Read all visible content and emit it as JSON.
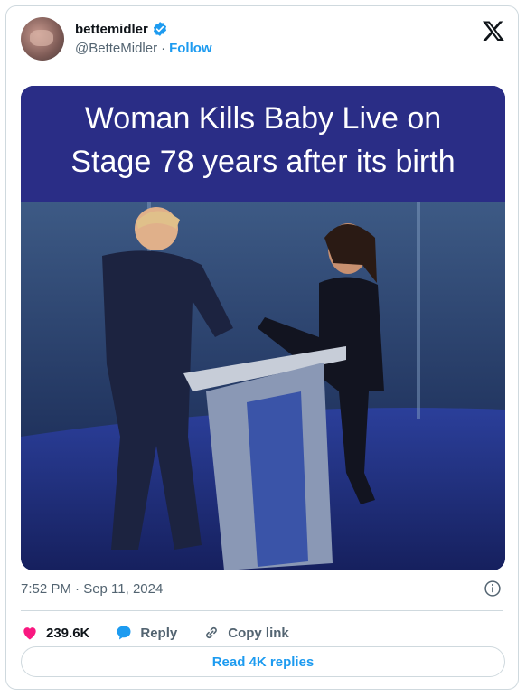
{
  "author": {
    "display_name": "bettemidler",
    "handle": "@BetteMidler",
    "separator": "·",
    "follow_label": "Follow"
  },
  "media": {
    "banner_line1": "Woman Kills Baby Live on",
    "banner_line2": "Stage 78 years after its birth"
  },
  "meta": {
    "timestamp": "7:52 PM · Sep 11, 2024"
  },
  "actions": {
    "likes": "239.6K",
    "reply_label": "Reply",
    "copy_label": "Copy link"
  },
  "footer": {
    "read_replies_label": "Read 4K replies"
  },
  "colors": {
    "accent": "#1d9bf0",
    "like": "#f91880",
    "banner_bg": "#2a2d86"
  }
}
